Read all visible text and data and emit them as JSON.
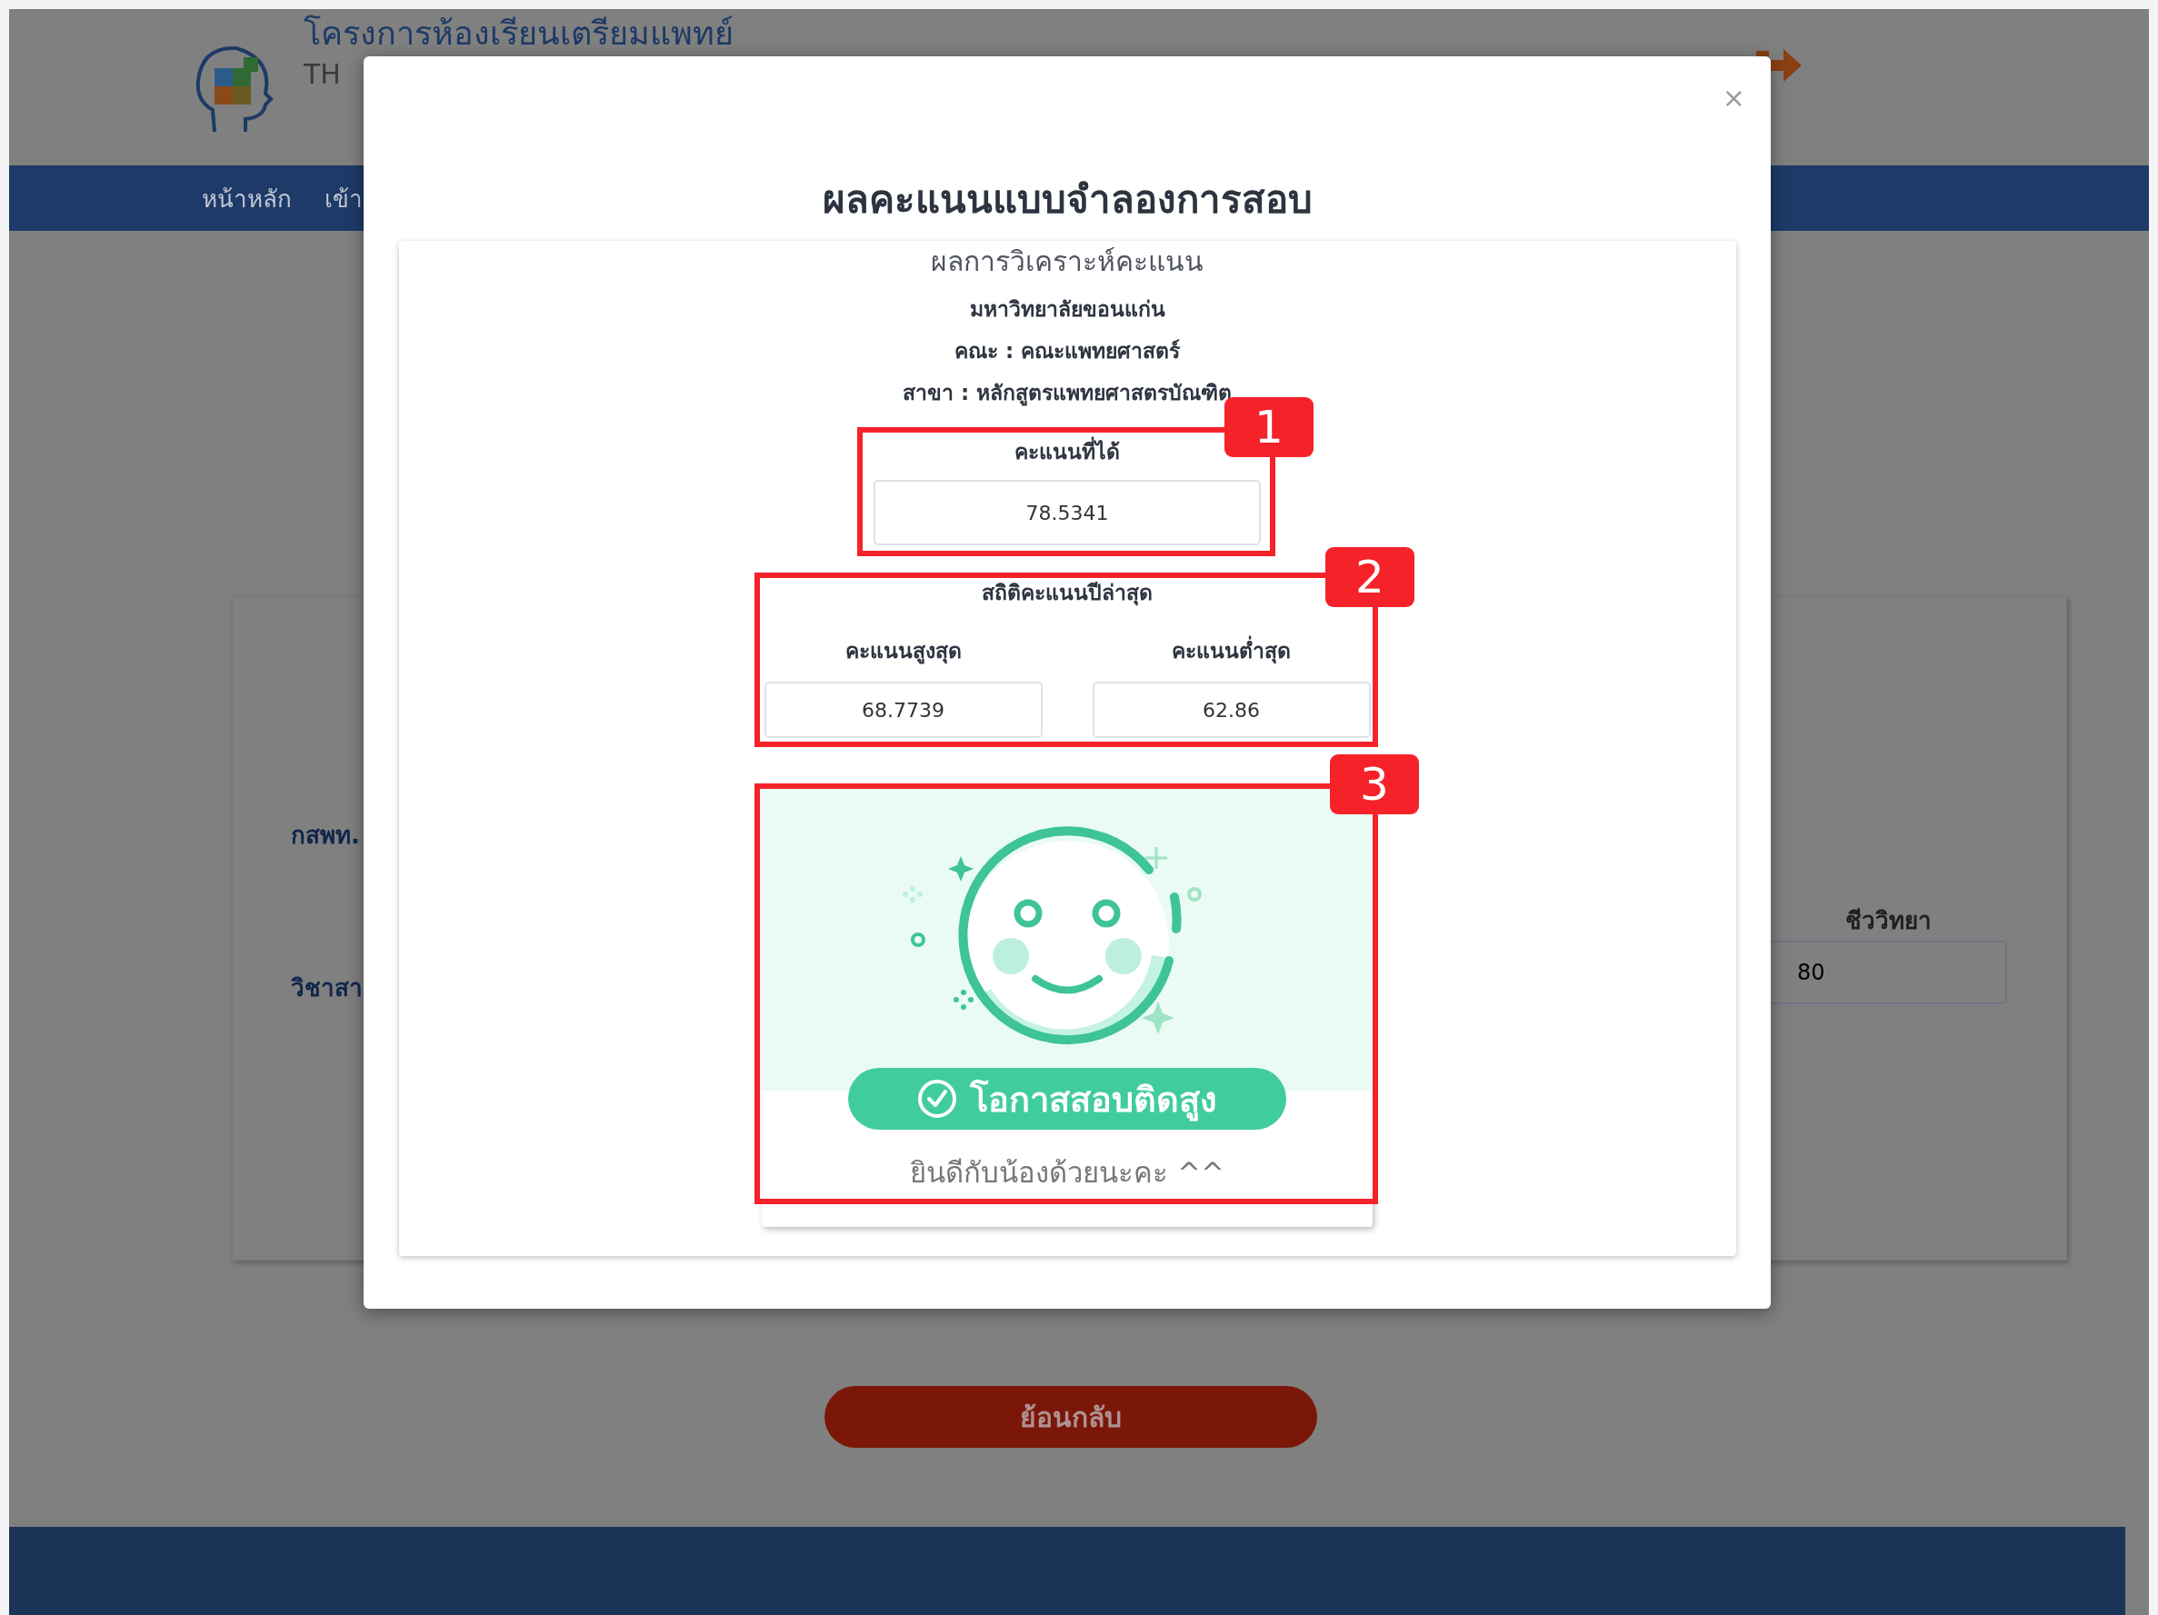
{
  "header": {
    "title": "โครงการห้องเรียนเตรียมแพทย์",
    "subtitle": "TH"
  },
  "nav": {
    "items": [
      "หน้าหลัก",
      "เข้า"
    ]
  },
  "form": {
    "labels": [
      "กสพท.",
      "วิชาสา"
    ],
    "subject": {
      "label": "ชีววิทยา",
      "value": "80"
    }
  },
  "back_button": "ย้อนกลับ",
  "modal": {
    "close": "×",
    "title": "ผลคะแนนแบบจำลองการสอบ",
    "card": {
      "heading": "ผลการวิเคราะห์คะแนน",
      "lines": [
        "มหาวิทยาลัยขอนแก่น",
        "คณะ : คณะแพทยศาสตร์",
        "สาขา : หลักสูตรแพทยศาสตรบัณฑิต"
      ],
      "score": {
        "label": "คะแนนที่ได้",
        "value": "78.5341"
      },
      "stats": {
        "title": "สถิติคะแนนปีล่าสุด",
        "items": [
          {
            "label": "คะแนนสูงสุด",
            "value": "68.7739"
          },
          {
            "label": "คะแนนต่ำสุด",
            "value": "62.86"
          }
        ]
      },
      "result": {
        "badge": "โอกาสสอบติดสูง",
        "message": "ยินดีกับน้องด้วยนะคะ ^^"
      }
    }
  },
  "annotations": [
    {
      "label": "1"
    },
    {
      "label": "2"
    },
    {
      "label": "3"
    }
  ]
}
